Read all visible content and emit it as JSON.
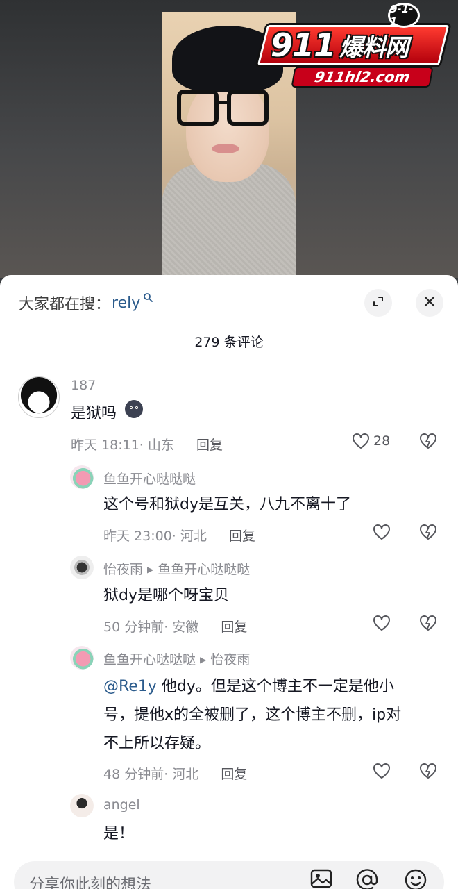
{
  "logo": {
    "badge": "9-1-1",
    "brand_num": "911",
    "brand_cn": "爆料网",
    "url": "911hl2.com"
  },
  "sheet": {
    "search_prefix": "大家都在搜：",
    "search_keyword": "rely",
    "comment_count": "279 条评论"
  },
  "comments": [
    {
      "user": "187",
      "text": "是狱吗",
      "time": "昨天 18:11",
      "location": "山东",
      "reply_label": "回复",
      "likes": "28"
    },
    {
      "user": "鱼鱼开心哒哒哒",
      "text": "这个号和狱dy是互关，八九不离十了",
      "time": "昨天 23:00",
      "location": "河北",
      "reply_label": "回复"
    },
    {
      "user": "怡夜雨",
      "reply_to": "鱼鱼开心哒哒哒",
      "text": "狱dy是哪个呀宝贝",
      "time": "50 分钟前",
      "location": "安徽",
      "reply_label": "回复"
    },
    {
      "user": "鱼鱼开心哒哒哒",
      "reply_to": "怡夜雨",
      "mention": "@Re1y",
      "text_line1": " 他dy。但是这个博主不一定是他小",
      "text_line2": "号，提他x的全被删了，这个博主不删，ip对",
      "text_line3": "不上所以存疑。",
      "time": "48 分钟前",
      "location": "河北",
      "reply_label": "回复"
    },
    {
      "user": "angel",
      "text": "是！"
    }
  ],
  "input": {
    "placeholder": "分享你此刻的想法"
  },
  "icons": [
    "search-icon",
    "expand-icon",
    "close-icon",
    "like-icon",
    "dislike-icon",
    "image-icon",
    "at-icon",
    "emoji-icon",
    "dark-face-emoji-icon"
  ]
}
